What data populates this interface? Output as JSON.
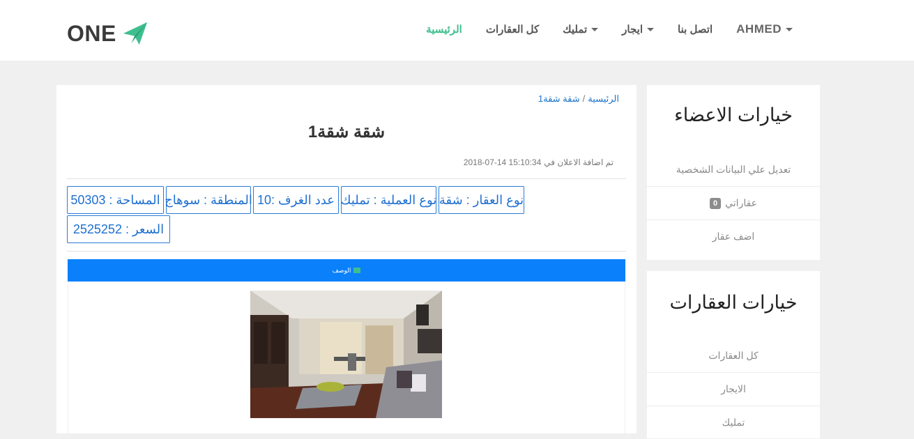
{
  "brand": {
    "name": "ONE"
  },
  "nav": {
    "home": "الرئيسية",
    "all_properties": "كل العقارات",
    "ownership": "تمليك",
    "rent": "ايجار",
    "contact": "اتصل بنا",
    "user": "AHMED"
  },
  "breadcrumb": {
    "home": "الرئيسية",
    "separator": "/",
    "current": "شقة شقة1"
  },
  "listing": {
    "title": "شقة شقة1",
    "posted_label": "تم اضافة الاعلان في",
    "posted_date": "2018-07-14 15:10:34",
    "tags": [
      "نوع العقار : شقة",
      "نوع العملية : تمليك",
      "عدد الغرف :10",
      "المنطقة : سوهاج",
      "المساحة : 50303",
      "السعر : 2525252"
    ],
    "description_label": "الوصف"
  },
  "members_sidebar": {
    "title": "خيارات الاعضاء",
    "items": [
      {
        "label": "تعديل علي البيانات الشخصية"
      },
      {
        "label": "عقاراتي",
        "badge": "0"
      },
      {
        "label": "اضف عقار"
      }
    ]
  },
  "properties_sidebar": {
    "title": "خيارات العقارات",
    "items": [
      {
        "label": "كل العقارات"
      },
      {
        "label": "الايجار"
      },
      {
        "label": "تمليك"
      }
    ]
  },
  "colors": {
    "accent_green": "#3fbf8f",
    "link_blue": "#1a73c9",
    "desc_bar_blue": "#0a80fb"
  }
}
